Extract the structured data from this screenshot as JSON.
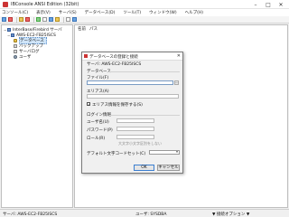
{
  "window": {
    "title": "IBConsole ANSI Edition (32bit)",
    "min": "–",
    "max": "□",
    "close": "✕"
  },
  "menu": [
    "コンソール(C)",
    "表示(V)",
    "サーバ(S)",
    "データベース(D)",
    "ツール(T)",
    "ウィンドウ(W)",
    "ヘルプ(H)"
  ],
  "toolbar": {
    "icons": [
      "server-connect-icon",
      "server-disconnect-icon",
      "database-connect-icon",
      "database-disconnect-icon",
      "sql-icon",
      "properties-icon",
      "backup-icon",
      "restore-icon",
      "users-icon",
      "help-icon"
    ]
  },
  "tree": {
    "root": "InterBase/Firebird サーバ",
    "server": "AWS-EC2-FB25ISCS",
    "items": [
      "データベース",
      "バックアップ",
      "サーバログ",
      "ユーザ"
    ]
  },
  "list": {
    "col_name": "名前",
    "col_path": "パス"
  },
  "status": {
    "server": "サーバ: AWS-EC2-FB25ISCS",
    "user": "ユーザ: SYSDBA",
    "hint": "▼ 接続オプション ▼"
  },
  "dialog": {
    "title": "データベースの登録と接続",
    "server_label": "サーバ: AWS-EC2-FB25ISCS",
    "db_group": "データベース",
    "file_label": "ファイル(F)",
    "file_value": "",
    "alias_label": "エリアス(A)",
    "alias_value": "",
    "save_alias_label": "エリアス情報を保存する(S)",
    "save_alias_checked": true,
    "login_group": "ログイン情報",
    "user_label": "ユーザ名(U)",
    "password_label": "パスワード(P)",
    "role_label": "ロール(R)",
    "case_hint": "大文字小文字区別をしない",
    "charset_label": "デフォルト文字コードセット(C)",
    "charset_value": "",
    "ok": "OK",
    "cancel": "キャンセル"
  }
}
